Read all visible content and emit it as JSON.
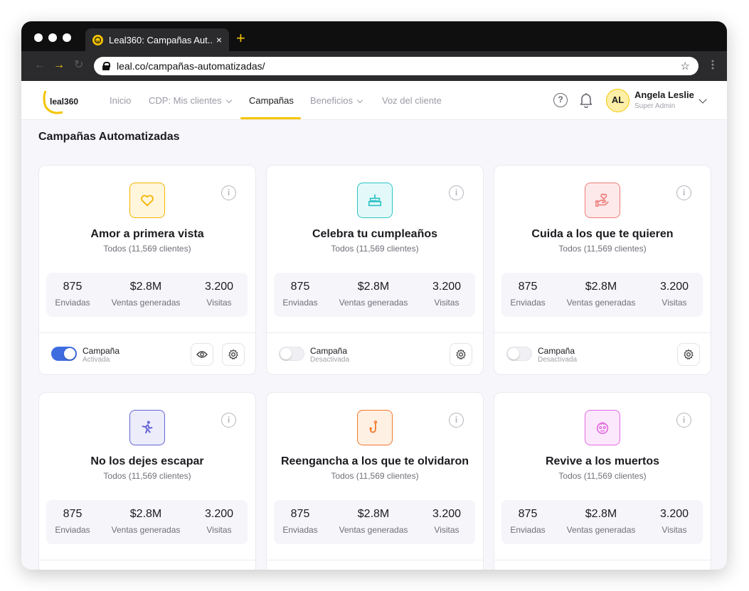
{
  "browser": {
    "tab_title": "Leal360: Campañas Aut...",
    "tab_close": "×",
    "new_tab": "+",
    "url": "leal.co/campañas-automatizadas/"
  },
  "nav": {
    "logo": "leal360",
    "items": [
      {
        "label": "Inicio"
      },
      {
        "label": "CDP: Mis clientes"
      },
      {
        "label": "Campañas"
      },
      {
        "label": "Beneficios"
      },
      {
        "label": "Voz del cliente"
      }
    ],
    "help": "?",
    "user": {
      "initials": "AL",
      "name": "Angela Leslie",
      "role": "Super Admin"
    }
  },
  "page": {
    "title": "Campañas Automatizadas"
  },
  "cards": [
    {
      "title": "Amor a primera vista",
      "subtitle": "Todos (11,569 clientes)",
      "icon": "heart-icon",
      "color": "#f5b400",
      "bg": "#fff6dc",
      "stats": [
        {
          "value": "875",
          "label": "Enviadas"
        },
        {
          "value": "$2.8M",
          "label": "Ventas generadas"
        },
        {
          "value": "3.200",
          "label": "Visitas"
        }
      ],
      "toggle_label": "Campaña",
      "toggle_state": "Activada",
      "active": true
    },
    {
      "title": "Celebra tu cumpleaños",
      "subtitle": "Todos (11,569 clientes)",
      "icon": "cake-icon",
      "color": "#2ec2c6",
      "bg": "#e3f9f9",
      "stats": [
        {
          "value": "875",
          "label": "Enviadas"
        },
        {
          "value": "$2.8M",
          "label": "Ventas generadas"
        },
        {
          "value": "3.200",
          "label": "Visitas"
        }
      ],
      "toggle_label": "Campaña",
      "toggle_state": "Desactivada",
      "active": false
    },
    {
      "title": "Cuida a los que te quieren",
      "subtitle": "Todos (11,569 clientes)",
      "icon": "hand-heart-icon",
      "color": "#ef7b7b",
      "bg": "#fde9e9",
      "stats": [
        {
          "value": "875",
          "label": "Enviadas"
        },
        {
          "value": "$2.8M",
          "label": "Ventas generadas"
        },
        {
          "value": "3.200",
          "label": "Visitas"
        }
      ],
      "toggle_label": "Campaña",
      "toggle_state": "Desactivada",
      "active": false
    },
    {
      "title": "No los dejes escapar",
      "subtitle": "Todos (11,569 clientes)",
      "icon": "running-person-icon",
      "color": "#6464d6",
      "bg": "#ececfb",
      "stats": [
        {
          "value": "875",
          "label": "Enviadas"
        },
        {
          "value": "$2.8M",
          "label": "Ventas generadas"
        },
        {
          "value": "3.200",
          "label": "Visitas"
        }
      ]
    },
    {
      "title": "Reengancha a los que te olvidaron",
      "subtitle": "Todos (11,569 clientes)",
      "icon": "fishing-hook-icon",
      "color": "#f07a2b",
      "bg": "#fff0e4",
      "stats": [
        {
          "value": "875",
          "label": "Enviadas"
        },
        {
          "value": "$2.8M",
          "label": "Ventas generadas"
        },
        {
          "value": "3.200",
          "label": "Visitas"
        }
      ]
    },
    {
      "title": "Revive a los muertos",
      "subtitle": "Todos (11,569 clientes)",
      "icon": "zombie-face-icon",
      "color": "#e06be0",
      "bg": "#fce8fc",
      "stats": [
        {
          "value": "875",
          "label": "Enviadas"
        },
        {
          "value": "$2.8M",
          "label": "Ventas generadas"
        },
        {
          "value": "3.200",
          "label": "Visitas"
        }
      ]
    }
  ]
}
